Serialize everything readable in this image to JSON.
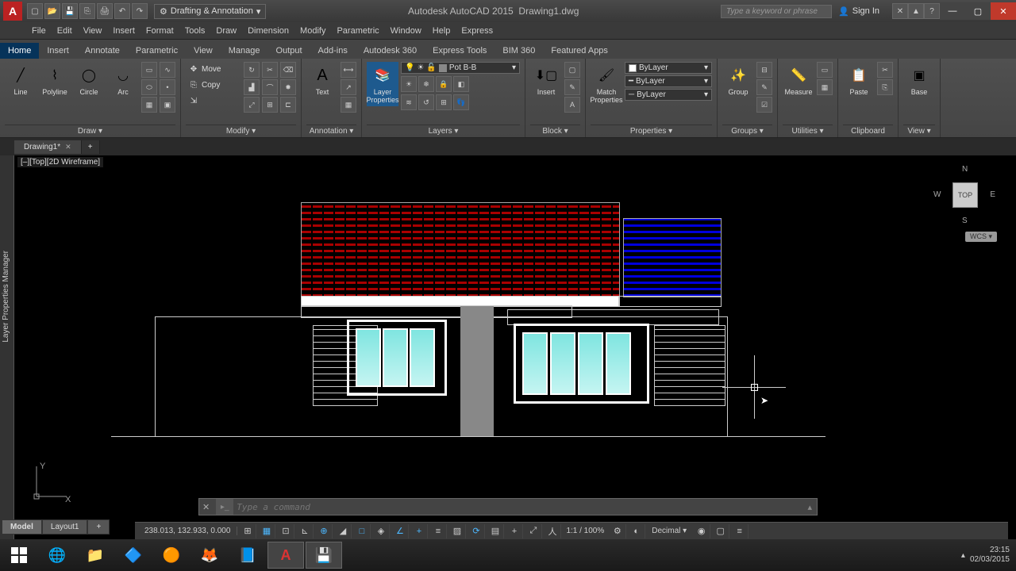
{
  "app": {
    "title": "Autodesk AutoCAD 2015",
    "file": "Drawing1.dwg"
  },
  "search_placeholder": "Type a keyword or phrase",
  "signin": "Sign In",
  "workspace": "Drafting & Annotation",
  "menus": [
    "File",
    "Edit",
    "View",
    "Insert",
    "Format",
    "Tools",
    "Draw",
    "Dimension",
    "Modify",
    "Parametric",
    "Window",
    "Help",
    "Express"
  ],
  "tabs": [
    "Home",
    "Insert",
    "Annotate",
    "Parametric",
    "View",
    "Manage",
    "Output",
    "Add-ins",
    "Autodesk 360",
    "Express Tools",
    "BIM 360",
    "Featured Apps"
  ],
  "active_tab": "Home",
  "draw": {
    "line": "Line",
    "polyline": "Polyline",
    "circle": "Circle",
    "arc": "Arc",
    "title": "Draw ▾"
  },
  "modify": {
    "move": "Move",
    "copy": "Copy",
    "title": "Modify ▾"
  },
  "annotation": {
    "text": "Text",
    "title": "Annotation ▾"
  },
  "layers": {
    "btn": "Layer\nProperties",
    "current": "Pot B-B",
    "title": "Layers ▾"
  },
  "block": {
    "insert": "Insert",
    "title": "Block ▾"
  },
  "properties": {
    "match": "Match\nProperties",
    "by": "ByLayer",
    "title": "Properties ▾"
  },
  "groups": {
    "group": "Group",
    "title": "Groups ▾"
  },
  "utilities": {
    "measure": "Measure",
    "title": "Utilities ▾"
  },
  "clipboard": {
    "paste": "Paste",
    "title": "Clipboard"
  },
  "view": {
    "base": "Base",
    "title": "View ▾"
  },
  "filetab": "Drawing1*",
  "vp_label": "[–][Top][2D Wireframe]",
  "side_panel": "Layer Properties Manager",
  "viewcube": {
    "face": "TOP",
    "n": "N",
    "s": "S",
    "e": "E",
    "w": "W",
    "wcs": "WCS ▾"
  },
  "ucs": {
    "x": "X",
    "y": "Y"
  },
  "cmd_placeholder": "Type a command",
  "model_tabs": {
    "model": "Model",
    "layout": "Layout1",
    "add": "+"
  },
  "coords": "238.013, 132.933, 0.000",
  "zoom": "1:1 / 100%",
  "units": "Decimal",
  "clock": {
    "time": "23:15",
    "date": "02/03/2015"
  }
}
